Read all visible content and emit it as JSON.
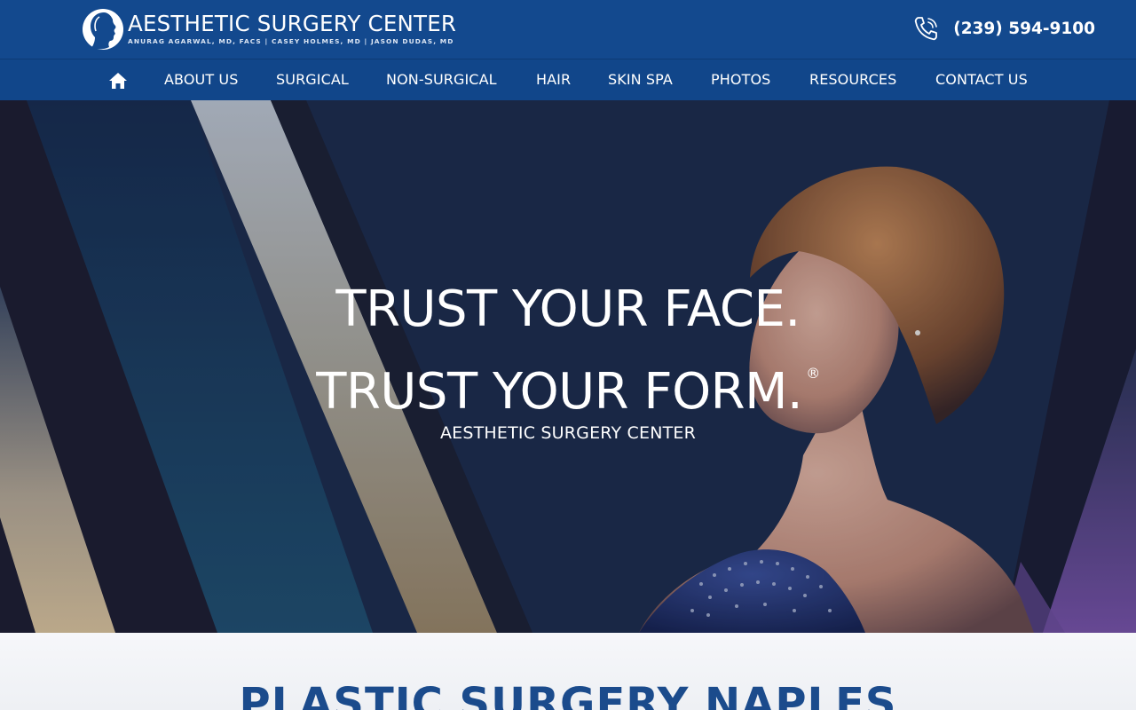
{
  "header": {
    "logo_title": "AESTHETIC SURGERY CENTER",
    "logo_subtitle": "ANURAG AGARWAL, MD, FACS | CASEY HOLMES, MD | JASON DUDAS, MD",
    "logo_icon": "profile-silhouette-icon",
    "phone_icon": "phone-icon",
    "phone_number": "(239) 594-9100",
    "background_color": "#13498e"
  },
  "nav": {
    "home_icon": "home-icon",
    "items": [
      {
        "label": "ABOUT US"
      },
      {
        "label": "SURGICAL"
      },
      {
        "label": "NON-SURGICAL"
      },
      {
        "label": "HAIR"
      },
      {
        "label": "SKIN SPA"
      },
      {
        "label": "PHOTOS"
      },
      {
        "label": "RESOURCES"
      },
      {
        "label": "CONTACT US"
      }
    ],
    "background_color": "#11468a"
  },
  "hero": {
    "line1": "TRUST YOUR FACE.",
    "line2": "TRUST YOUR FORM.",
    "registered_mark": "®",
    "subtitle": "AESTHETIC SURGERY CENTER"
  },
  "intro": {
    "heading": "PLASTIC SURGERY NAPLES",
    "heading_color": "#1b4b8c"
  }
}
